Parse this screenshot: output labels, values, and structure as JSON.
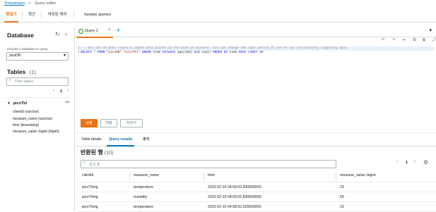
{
  "breadcrumb": {
    "root": "Timestream",
    "separator": ">",
    "current": "Query editor"
  },
  "top_tabs": [
    "편집기",
    "최근",
    "저장된 쿼리",
    "Sample queries"
  ],
  "left_panel": {
    "database_title": "Database",
    "choose_label": "Choose a database to query",
    "selected_database": "picoDB",
    "tables_title": "Tables",
    "tables_count": "(1)",
    "filter_placeholder": "Filter tables",
    "page": "1",
    "table_name": "picoTbl",
    "columns": [
      "clientId (varchar)",
      "measure_name (varchar)",
      "time (timestamp)",
      "measure_value::bigint (bigint)"
    ]
  },
  "editor": {
    "tab_label": "Query 1",
    "line1_num": "1",
    "line1_text": "-- Get the 10 most recently added data points in the past 15 minutes. You can change the time period if you're not continuously ingesting data",
    "line2_num": "2",
    "line2": {
      "select": "SELECT",
      "star": " * ",
      "from": "FROM",
      "table": " \"picoDB\".\"picoTbl\" ",
      "where": "WHERE",
      "time1": " time ",
      "between": "between",
      "ago": " ago(15m) ",
      "and": "and",
      "now": " now() ",
      "order": "ORDER BY",
      "time2": " time ",
      "desc": "DESC",
      "limit": " LIMIT ",
      "limit_val": "10"
    }
  },
  "actions": {
    "run": "실행",
    "save": "저장",
    "clear": "지우기"
  },
  "result_tabs": [
    "Table details",
    "Query results",
    "출력"
  ],
  "results": {
    "title": "반환된 행",
    "count": "(10)",
    "search_placeholder": "검색 행",
    "page": "1",
    "columns": [
      "clientId",
      "measure_name",
      "time",
      "measure_value::bigint"
    ],
    "rows": [
      [
        "picoThing",
        "temperature",
        "2022-02-15 04:59:02.830000000",
        "23"
      ],
      [
        "picoThing",
        "humidity",
        "2022-02-15 04:59:02.830000000",
        "55"
      ],
      [
        "picoThing",
        "temperature",
        "2022-02-15 04:58:52.625000000",
        "23"
      ]
    ]
  },
  "colors": {
    "accent": "#ec7211",
    "link": "#0073bb",
    "success": "#1d8102"
  }
}
